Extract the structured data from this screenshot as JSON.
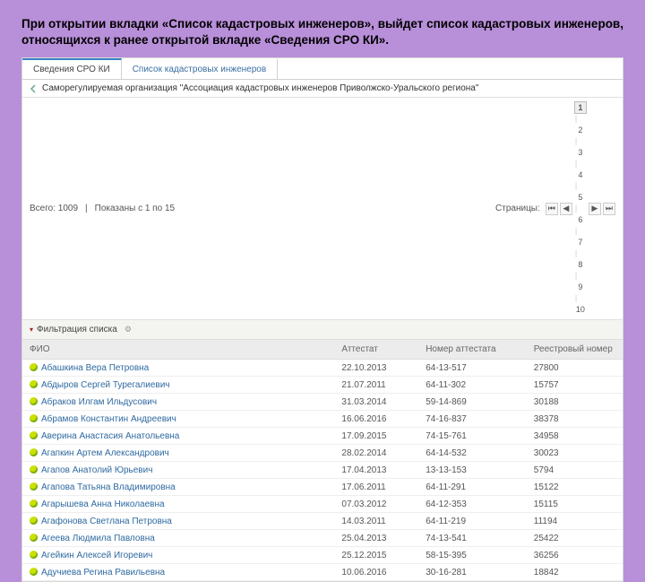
{
  "intro": "При открытии вкладки «Список кадастровых инженеров», выйдет список кадастровых инженеров, относящихся к ранее открытой вкладке «Сведения СРО КИ».",
  "tabs": {
    "info": "Сведения СРО КИ",
    "list": "Список кадастровых инженеров"
  },
  "org": "Саморегулируемая организация \"Ассоциация кадастровых инженеров Приволжско-Уральского региона\"",
  "countbar": {
    "total_label": "Всего: 1009",
    "shown_label": "Показаны с 1  по 15",
    "pages_label": "Страницы:",
    "pages": [
      "1",
      "2",
      "3",
      "4",
      "5",
      "6",
      "7",
      "8",
      "9",
      "10"
    ],
    "active_page": "1"
  },
  "filter_label": "Фильтрация списка",
  "columns": {
    "fio": "ФИО",
    "attestat": "Аттестат",
    "cert_no": "Номер аттестата",
    "reg_no": "Реестровый номер"
  },
  "rows": [
    {
      "fio": "Абашкина Вера Петровна",
      "date": "22.10.2013",
      "cert": "64-13-517",
      "reg": "27800"
    },
    {
      "fio": "Абдыров Сергей Турегалиевич",
      "date": "21.07.2011",
      "cert": "64-11-302",
      "reg": "15757"
    },
    {
      "fio": "Абраков Илгам Ильдусович",
      "date": "31.03.2014",
      "cert": "59-14-869",
      "reg": "30188"
    },
    {
      "fio": "Абрамов Константин Андреевич",
      "date": "16.06.2016",
      "cert": "74-16-837",
      "reg": "38378"
    },
    {
      "fio": "Аверина Анастасия Анатольевна",
      "date": "17.09.2015",
      "cert": "74-15-761",
      "reg": "34958"
    },
    {
      "fio": "Агапкин Артем Александрович",
      "date": "28.02.2014",
      "cert": "64-14-532",
      "reg": "30023"
    },
    {
      "fio": "Агапов Анатолий Юрьевич",
      "date": "17.04.2013",
      "cert": "13-13-153",
      "reg": "5794"
    },
    {
      "fio": "Агапова Татьяна Владимировна",
      "date": "17.06.2011",
      "cert": "64-11-291",
      "reg": "15122"
    },
    {
      "fio": "Агарышева Анна Николаевна",
      "date": "07.03.2012",
      "cert": "64-12-353",
      "reg": "15115"
    },
    {
      "fio": "Агафонова Светлана Петровна",
      "date": "14.03.2011",
      "cert": "64-11-219",
      "reg": "11194"
    },
    {
      "fio": "Агеева Людмила Павловна",
      "date": "25.04.2013",
      "cert": "74-13-541",
      "reg": "25422"
    },
    {
      "fio": "Агейкин Алексей Игоревич",
      "date": "25.12.2015",
      "cert": "58-15-395",
      "reg": "36256"
    },
    {
      "fio": "Адучиева Регина Равильевна",
      "date": "10.06.2016",
      "cert": "30-16-281",
      "reg": "18842"
    }
  ]
}
